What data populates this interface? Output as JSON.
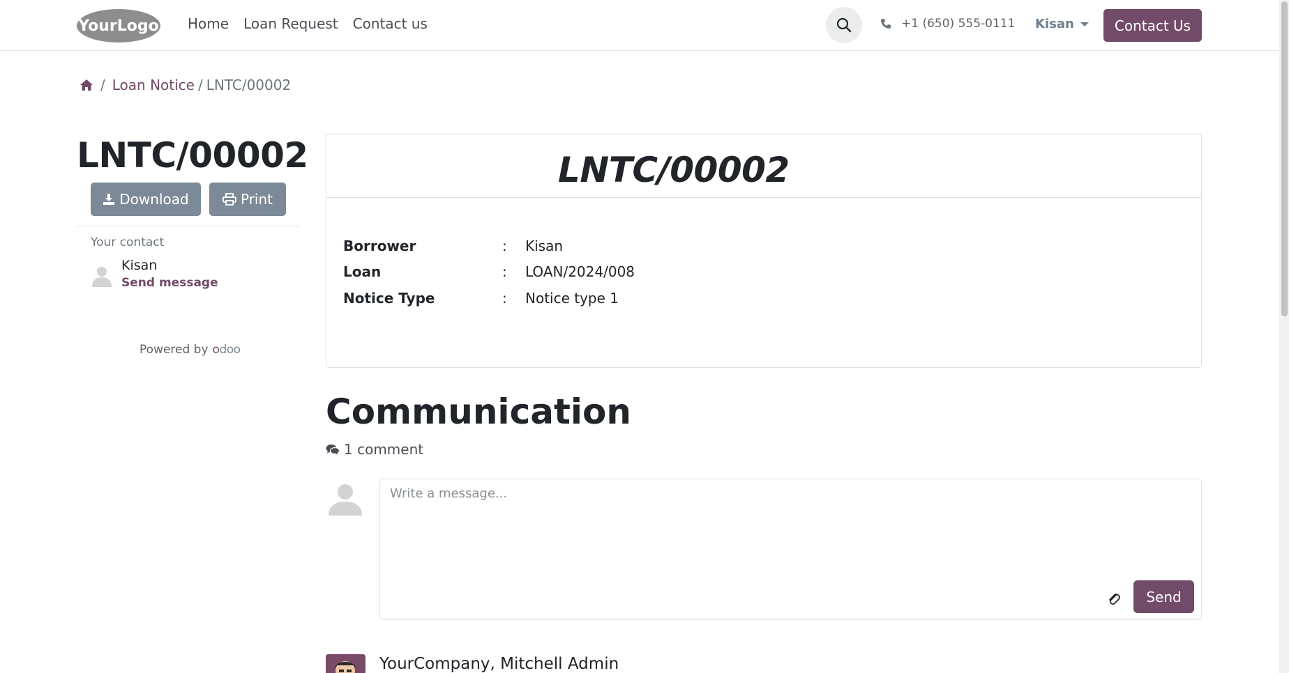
{
  "header": {
    "logo_text": "YourLogo",
    "nav": [
      "Home",
      "Loan Request",
      "Contact us"
    ],
    "phone": "+1 (650) 555-0111",
    "user": "Kisan",
    "contact_button": "Contact Us"
  },
  "breadcrumb": {
    "parent": "Loan Notice",
    "current": "LNTC/00002"
  },
  "sidebar": {
    "title": "LNTC/00002",
    "download_label": "Download",
    "print_label": "Print",
    "your_contact_label": "Your contact",
    "contact_name": "Kisan",
    "send_message_label": "Send message",
    "powered_by": "Powered by",
    "powered_brand": "odoo"
  },
  "card": {
    "title": "LNTC/00002",
    "rows": [
      {
        "label": "Borrower",
        "colon": ":",
        "value": "Kisan"
      },
      {
        "label": "Loan",
        "colon": ":",
        "value": "LOAN/2024/008"
      },
      {
        "label": "Notice Type",
        "colon": ":",
        "value": "Notice type 1"
      }
    ]
  },
  "communication": {
    "title": "Communication",
    "comment_count": "1 comment",
    "placeholder": "Write a message...",
    "send_label": "Send",
    "message_author": "YourCompany, Mitchell Admin"
  },
  "colors": {
    "primary": "#714b67",
    "secondary": "#7b8a96"
  }
}
